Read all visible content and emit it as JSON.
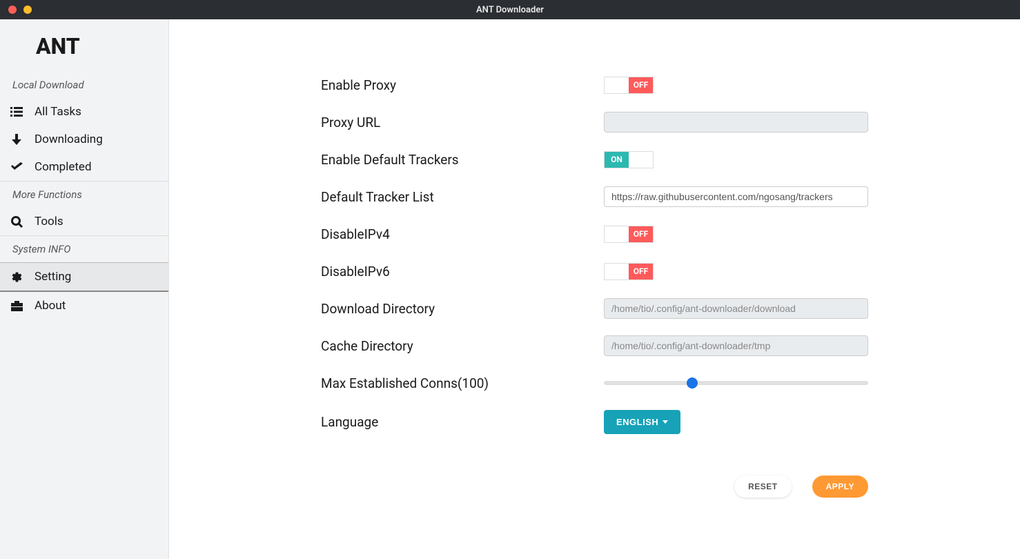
{
  "titlebar": {
    "title": "ANT Downloader"
  },
  "sidebar": {
    "logo": "ANT",
    "sections": {
      "local_download": "Local Download",
      "more_functions": "More Functions",
      "system_info": "System INFO"
    },
    "items": {
      "all_tasks": "All Tasks",
      "downloading": "Downloading",
      "completed": "Completed",
      "tools": "Tools",
      "setting": "Setting",
      "about": "About"
    }
  },
  "settings": {
    "labels": {
      "enable_proxy": "Enable Proxy",
      "proxy_url": "Proxy URL",
      "enable_default_trackers": "Enable Default Trackers",
      "default_tracker_list": "Default Tracker List",
      "disable_ipv4": "DisableIPv4",
      "disable_ipv6": "DisableIPv6",
      "download_directory": "Download Directory",
      "cache_directory": "Cache Directory",
      "max_conns": "Max Established Conns(100)",
      "language": "Language"
    },
    "values": {
      "enable_proxy": "OFF",
      "proxy_url": "",
      "enable_default_trackers": "ON",
      "default_tracker_list": "https://raw.githubusercontent.com/ngosang/trackers",
      "disable_ipv4": "OFF",
      "disable_ipv6": "OFF",
      "download_directory": "/home/tio/.config/ant-downloader/download",
      "cache_directory": "/home/tio/.config/ant-downloader/tmp",
      "max_conns_value": 100,
      "max_conns_max": 300,
      "language": "ENGLISH"
    },
    "toggle_labels": {
      "on": "ON",
      "off": "OFF"
    },
    "buttons": {
      "reset": "RESET",
      "apply": "APPLY"
    }
  }
}
